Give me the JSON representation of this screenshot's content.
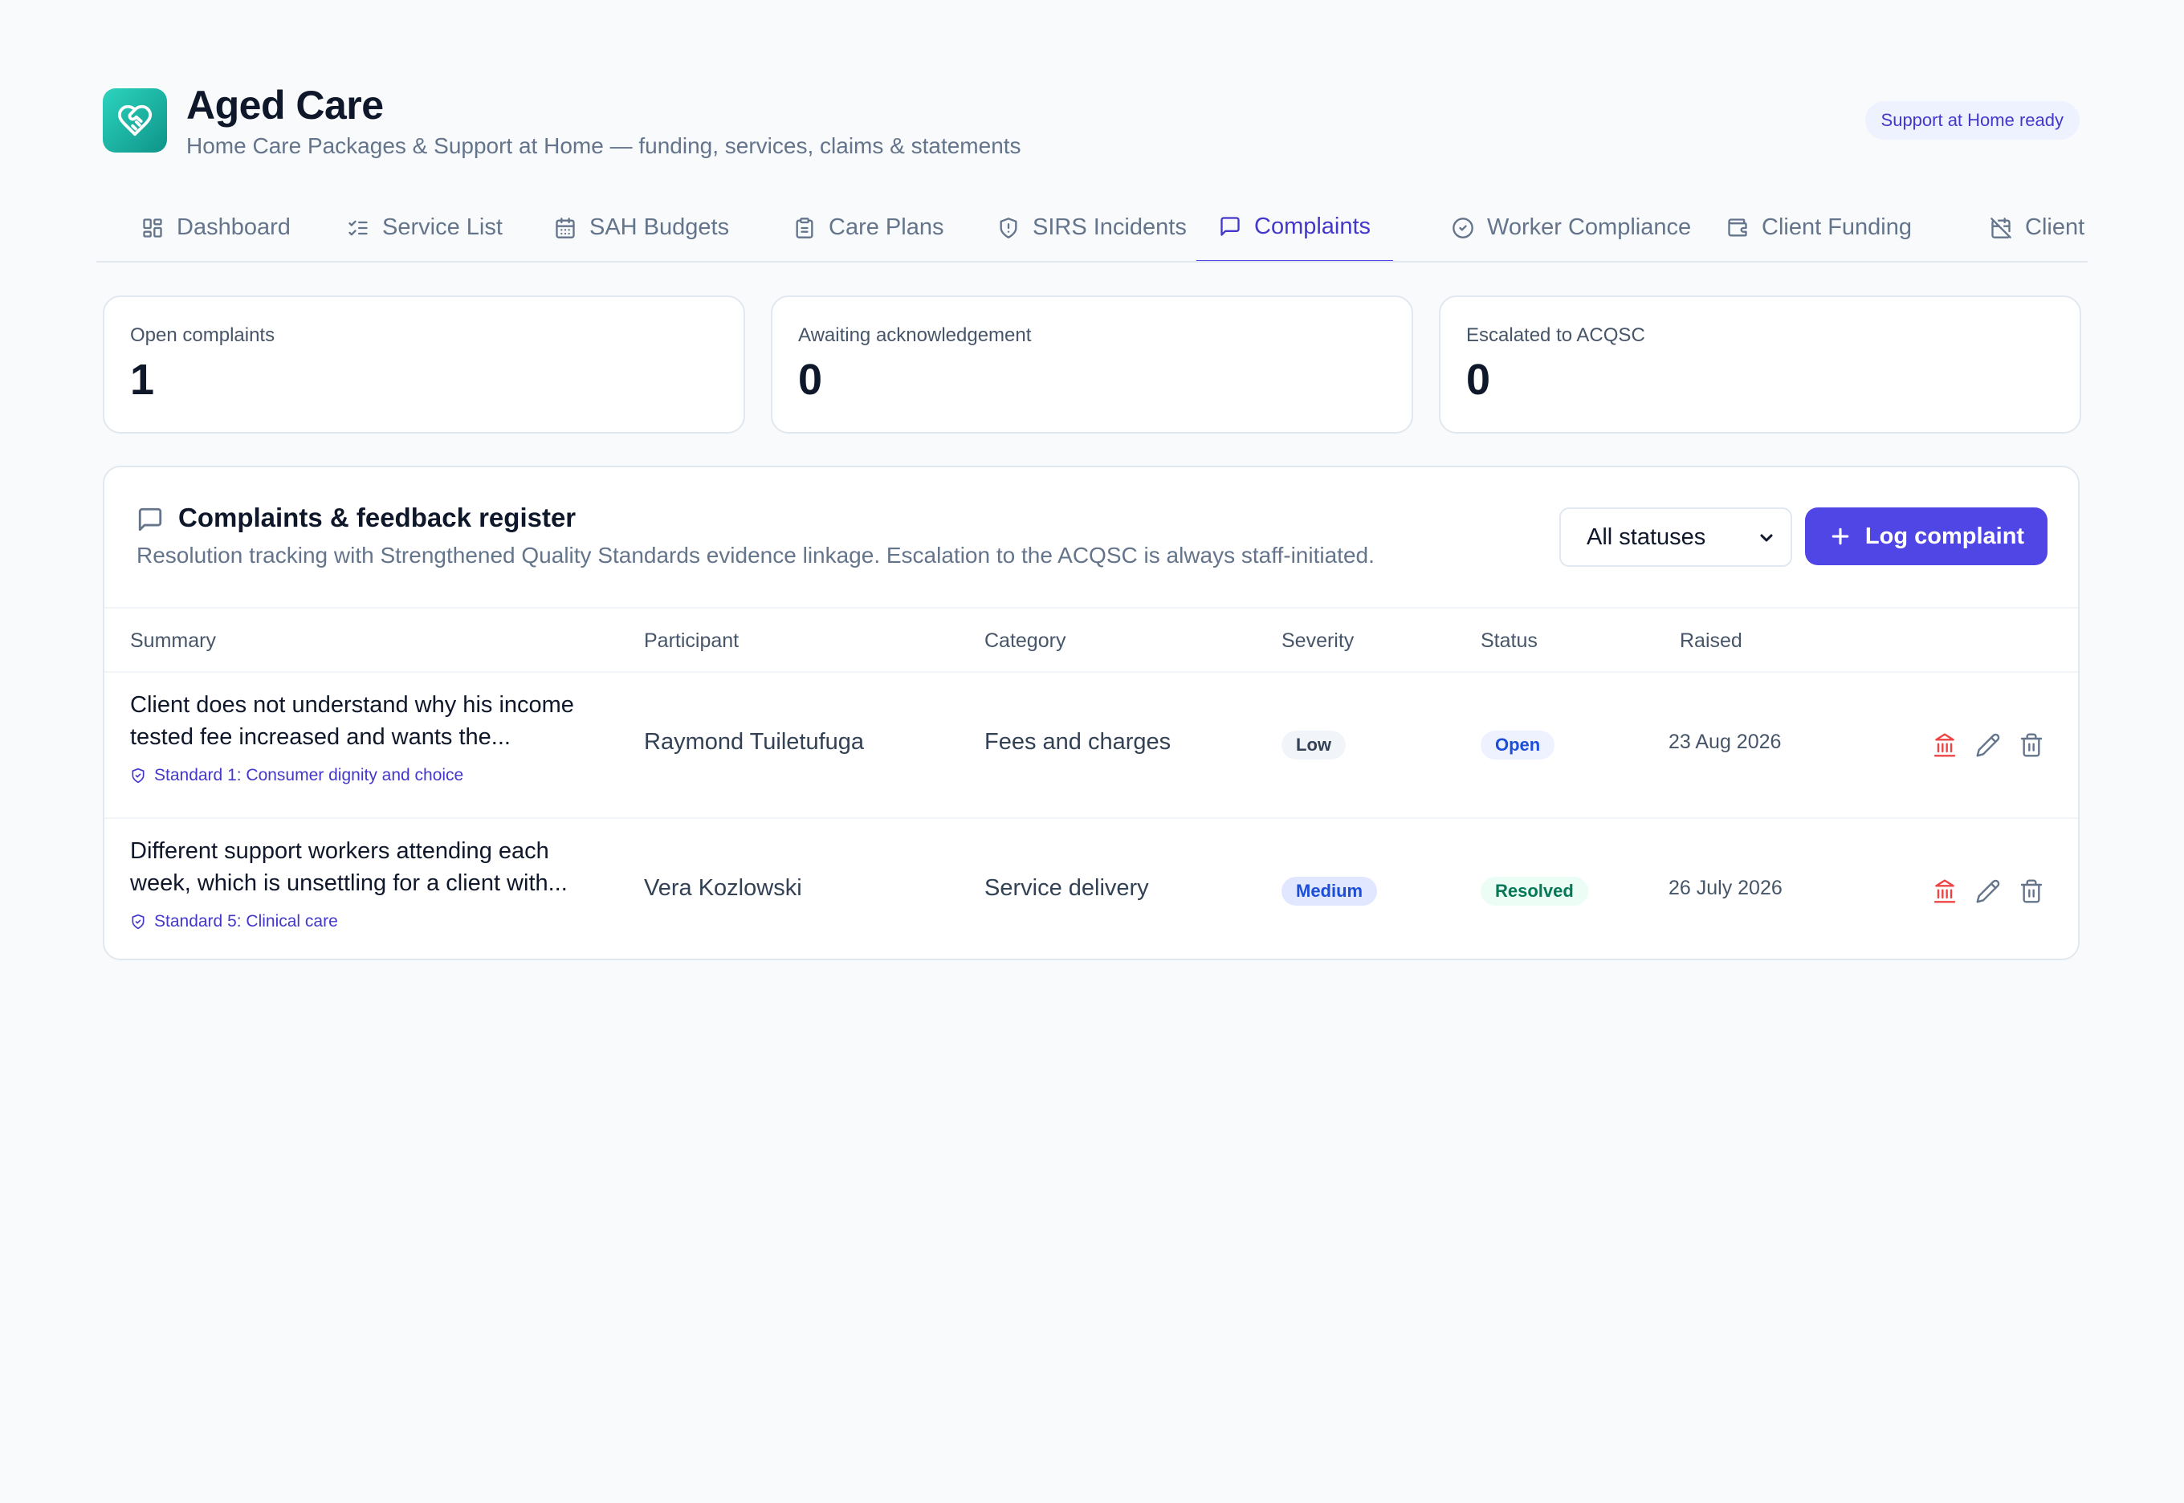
{
  "app": {
    "title": "Aged Care",
    "subtitle": "Home Care Packages & Support at Home — funding, services, claims & statements",
    "badge": "Support at Home ready"
  },
  "tabs": [
    {
      "label": "Dashboard",
      "icon": "grid-icon"
    },
    {
      "label": "Service List",
      "icon": "checklist-icon"
    },
    {
      "label": "SAH Budgets",
      "icon": "calendar-icon"
    },
    {
      "label": "Care Plans",
      "icon": "clipboard-icon"
    },
    {
      "label": "SIRS Incidents",
      "icon": "shield-alert-icon"
    },
    {
      "label": "Complaints",
      "icon": "message-square-icon",
      "active": true
    },
    {
      "label": "Worker Compliance",
      "icon": "check-circle-icon"
    },
    {
      "label": "Client Funding",
      "icon": "wallet-icon"
    },
    {
      "label": "Client L",
      "icon": "calendar-off-icon"
    }
  ],
  "stats": [
    {
      "label": "Open complaints",
      "value": "1"
    },
    {
      "label": "Awaiting acknowledgement",
      "value": "0"
    },
    {
      "label": "Escalated to ACQSC",
      "value": "0"
    }
  ],
  "register": {
    "title": "Complaints & feedback register",
    "description": "Resolution tracking with Strengthened Quality Standards evidence linkage. Escalation to the ACQSC is always staff-initiated.",
    "filter_value": "All statuses",
    "log_button": "Log complaint",
    "columns": [
      "Summary",
      "Participant",
      "Category",
      "Severity",
      "Status",
      "Raised"
    ],
    "rows": [
      {
        "summary_line1": "Client does not understand why his income",
        "summary_line2": "tested fee increased and wants the...",
        "standard": "Standard 1: Consumer dignity and choice",
        "participant": "Raymond Tuiletufuga",
        "category": "Fees and charges",
        "severity": "Low",
        "status": "Open",
        "raised": "23 Aug 2026"
      },
      {
        "summary_line1": "Different support workers attending each",
        "summary_line2": "week, which is unsettling for a client with...",
        "standard": "Standard 5: Clinical care",
        "participant": "Vera Kozlowski",
        "category": "Service delivery",
        "severity": "Medium",
        "status": "Resolved",
        "raised": "26 July 2026"
      }
    ]
  },
  "colors": {
    "accent": "#4f46e5",
    "accent_text": "#4338ca",
    "teal": "#14b8a6",
    "escalate_icon": "#ef4444"
  }
}
